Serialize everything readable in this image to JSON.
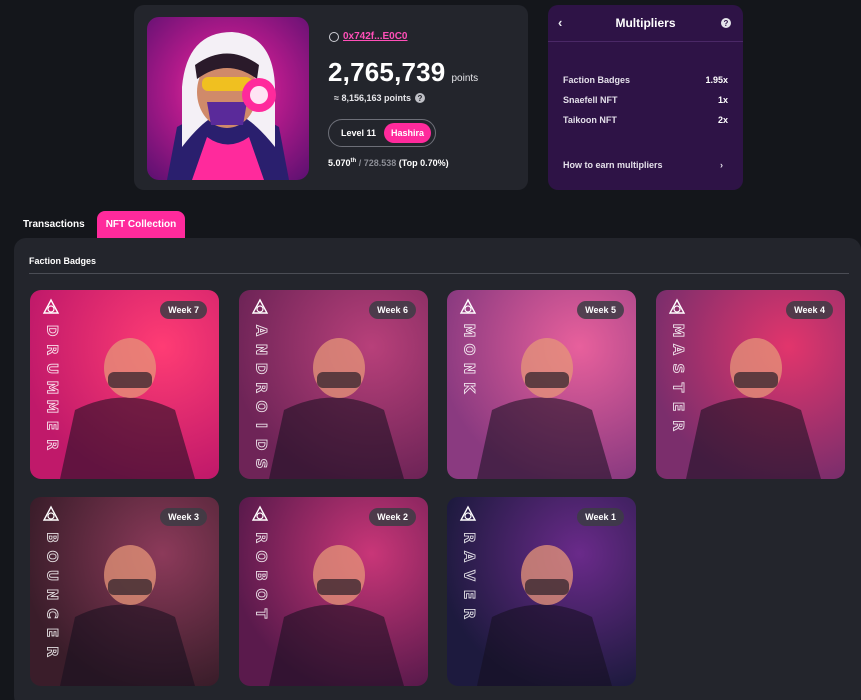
{
  "profile": {
    "address": "0x742f...E0C0",
    "points": "2,765,739",
    "points_unit": "points",
    "approx_points": "≈ 8,156,163 points",
    "level": "Level 11",
    "rank_name": "Hashira",
    "rank_position": "5.070",
    "rank_suffix": "th",
    "rank_total": "/ 728.538",
    "rank_top": "(Top 0.70%)"
  },
  "multipliers": {
    "title": "Multipliers",
    "items": [
      {
        "label": "Faction Badges",
        "value": "1.95x"
      },
      {
        "label": "Snaefell NFT",
        "value": "1x"
      },
      {
        "label": "Taikoon NFT",
        "value": "2x"
      }
    ],
    "how_to_earn": "How to earn multipliers"
  },
  "tabs": [
    {
      "label": "Transactions",
      "active": false
    },
    {
      "label": "NFT Collection",
      "active": true
    }
  ],
  "collection": {
    "section_title": "Faction Badges",
    "badges": [
      {
        "week": "Week 7",
        "name": "DRUMMER",
        "colors": [
          "#ff3c74",
          "#c0196a"
        ]
      },
      {
        "week": "Week 6",
        "name": "ANDROIDS",
        "colors": [
          "#b8407a",
          "#6e2457"
        ]
      },
      {
        "week": "Week 5",
        "name": "MONK",
        "colors": [
          "#e8609c",
          "#8a3a80"
        ]
      },
      {
        "week": "Week 4",
        "name": "MASTER",
        "colors": [
          "#e2356c",
          "#7b2e6c"
        ]
      },
      {
        "week": "Week 3",
        "name": "BOUNCER",
        "colors": [
          "#8c3a5a",
          "#3a1d2a"
        ]
      },
      {
        "week": "Week 2",
        "name": "ROBOT",
        "colors": [
          "#c93678",
          "#5a1a4c"
        ]
      },
      {
        "week": "Week 1",
        "name": "RAVER",
        "colors": [
          "#6a2a8a",
          "#1d1a3e"
        ]
      }
    ]
  }
}
